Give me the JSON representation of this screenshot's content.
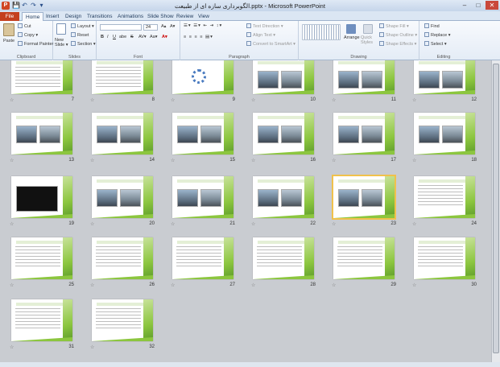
{
  "window": {
    "title": "الگوبرداری سازه ای از طبیعت.pptx - Microsoft PowerPoint",
    "minimize": "–",
    "maximize": "□",
    "close": "✕"
  },
  "app_icon": "P",
  "quick_access": [
    "💾",
    "↶",
    "↷",
    "▾"
  ],
  "tabs": {
    "file": "File",
    "items": [
      "Home",
      "Insert",
      "Design",
      "Transitions",
      "Animations",
      "Slide Show",
      "Review",
      "View"
    ]
  },
  "ribbon": {
    "clipboard": {
      "label": "Clipboard",
      "paste": "Paste",
      "cut": "Cut",
      "copy": "Copy ▾",
      "format_painter": "Format Painter"
    },
    "slides": {
      "label": "Slides",
      "new_slide": "New Slide ▾",
      "layout": "Layout ▾",
      "reset": "Reset",
      "section": "Section ▾"
    },
    "font": {
      "label": "Font",
      "size": "24",
      "bold": "B",
      "italic": "I",
      "underline": "U",
      "strike": "S",
      "shadow": "abe"
    },
    "paragraph": {
      "label": "Paragraph",
      "text_direction": "Text Direction ▾",
      "align_text": "Align Text ▾",
      "convert_smartart": "Convert to SmartArt ▾"
    },
    "drawing": {
      "label": "Drawing",
      "arrange": "Arrange",
      "quick_styles": "Quick Styles",
      "shape_fill": "Shape Fill ▾",
      "shape_outline": "Shape Outline ▾",
      "shape_effects": "Shape Effects ▾"
    },
    "editing": {
      "label": "Editing",
      "find": "Find",
      "replace": "Replace ▾",
      "select": "Select ▾"
    }
  },
  "slides": [
    {
      "n": "7",
      "row": 0,
      "col": 0,
      "title": "",
      "kind": "text"
    },
    {
      "n": "8",
      "row": 0,
      "col": 1,
      "title": "",
      "kind": "text"
    },
    {
      "n": "9",
      "row": 0,
      "col": 2,
      "title": "",
      "kind": "diagram"
    },
    {
      "n": "10",
      "row": 0,
      "col": 3,
      "title": "",
      "kind": "photos"
    },
    {
      "n": "11",
      "row": 0,
      "col": 4,
      "title": "",
      "kind": "photos"
    },
    {
      "n": "12",
      "row": 0,
      "col": 5,
      "title": "",
      "kind": "photos"
    },
    {
      "n": "13",
      "row": 1,
      "col": 0,
      "title": "",
      "kind": "photos"
    },
    {
      "n": "14",
      "row": 1,
      "col": 1,
      "title": "",
      "kind": "photos"
    },
    {
      "n": "15",
      "row": 1,
      "col": 2,
      "title": "",
      "kind": "photos"
    },
    {
      "n": "16",
      "row": 1,
      "col": 3,
      "title": "",
      "kind": "photos"
    },
    {
      "n": "17",
      "row": 1,
      "col": 4,
      "title": "",
      "kind": "photos"
    },
    {
      "n": "18",
      "row": 1,
      "col": 5,
      "title": "",
      "kind": "photos"
    },
    {
      "n": "19",
      "row": 2,
      "col": 0,
      "title": "",
      "kind": "dark"
    },
    {
      "n": "20",
      "row": 2,
      "col": 1,
      "title": "",
      "kind": "photos"
    },
    {
      "n": "21",
      "row": 2,
      "col": 2,
      "title": "",
      "kind": "photos"
    },
    {
      "n": "22",
      "row": 2,
      "col": 3,
      "title": "",
      "kind": "photos"
    },
    {
      "n": "23",
      "row": 2,
      "col": 4,
      "title": "",
      "kind": "photos",
      "selected": true
    },
    {
      "n": "24",
      "row": 2,
      "col": 5,
      "title": "",
      "kind": "text"
    },
    {
      "n": "25",
      "row": 3,
      "col": 0,
      "title": "",
      "kind": "text"
    },
    {
      "n": "26",
      "row": 3,
      "col": 1,
      "title": "",
      "kind": "text"
    },
    {
      "n": "27",
      "row": 3,
      "col": 2,
      "title": "",
      "kind": "text"
    },
    {
      "n": "28",
      "row": 3,
      "col": 3,
      "title": "",
      "kind": "text"
    },
    {
      "n": "29",
      "row": 3,
      "col": 4,
      "title": "",
      "kind": "text"
    },
    {
      "n": "30",
      "row": 3,
      "col": 5,
      "title": "",
      "kind": "text"
    },
    {
      "n": "31",
      "row": 4,
      "col": 0,
      "title": "",
      "kind": "text"
    },
    {
      "n": "32",
      "row": 4,
      "col": 1,
      "title": "",
      "kind": "text"
    }
  ],
  "colors": {
    "accent_green": "#8cc63f",
    "file_tab": "#c4401f"
  }
}
